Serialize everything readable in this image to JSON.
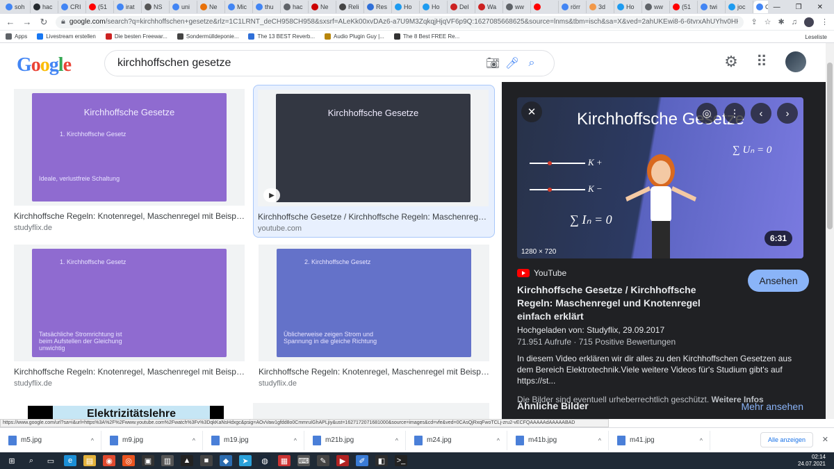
{
  "tabs": [
    {
      "label": "soh",
      "color": "#4285f4"
    },
    {
      "label": "hac",
      "color": "#24292e"
    },
    {
      "label": "CRI",
      "color": "#4285f4"
    },
    {
      "label": "(51",
      "color": "#ff0000"
    },
    {
      "label": "irat",
      "color": "#4285f4"
    },
    {
      "label": "NS",
      "color": "#555555"
    },
    {
      "label": "uni",
      "color": "#4285f4"
    },
    {
      "label": "Ne",
      "color": "#e8710a"
    },
    {
      "label": "Mic",
      "color": "#4285f4"
    },
    {
      "label": "thu",
      "color": "#4285f4"
    },
    {
      "label": "hac",
      "color": "#5f6368"
    },
    {
      "label": "Ne",
      "color": "#cc0000"
    },
    {
      "label": "Reli",
      "color": "#444444"
    },
    {
      "label": "Res",
      "color": "#2f6fd8"
    },
    {
      "label": "Ho",
      "color": "#1d9bf0"
    },
    {
      "label": "Ho",
      "color": "#1d9bf0"
    },
    {
      "label": "Del",
      "color": "#cc2222"
    },
    {
      "label": "Wa",
      "color": "#cc2222"
    },
    {
      "label": "ww",
      "color": "#5f6368"
    },
    {
      "label": "",
      "color": "#ff0000"
    },
    {
      "label": "rörr",
      "color": "#4285f4"
    },
    {
      "label": "3d",
      "color": "#f2994a"
    },
    {
      "label": "Ho",
      "color": "#1d9bf0"
    },
    {
      "label": "ww",
      "color": "#5f6368"
    },
    {
      "label": "(51",
      "color": "#ff0000"
    },
    {
      "label": "twi",
      "color": "#4285f4"
    },
    {
      "label": "joc",
      "color": "#1d9bf0"
    }
  ],
  "active_tab": {
    "label": "G",
    "color": "#4285f4"
  },
  "window": {
    "minimize": "—",
    "restore": "❐",
    "close": "✕"
  },
  "address": {
    "domain": "google.com",
    "rest": "/search?q=kirchhoffschen+gesetze&rlz=1C1LRNT_deCH958CH958&sxsrf=ALeKk00xvDAz6-a7U9M3ZqkqjHjqVF6p9Q:1627085668625&source=lnms&tbm=isch&sa=X&ved=2ahUKEwi8-6-6tvrxAhUYhv0HHa72D24Q_AUoAXoECAEQAw&biw=..."
  },
  "bookmarks": [
    {
      "label": "Apps",
      "color": "#5f6368"
    },
    {
      "label": "Livestream erstellen",
      "color": "#1877f2"
    },
    {
      "label": "Die besten Freewar...",
      "color": "#cc2222"
    },
    {
      "label": "Sondermülldeponie...",
      "color": "#444444"
    },
    {
      "label": "The 13 BEST Reverb...",
      "color": "#2f6fd8"
    },
    {
      "label": "Audio Plugin Guy |...",
      "color": "#b8860b"
    },
    {
      "label": "The 8 Best FREE Re...",
      "color": "#333333"
    }
  ],
  "reading_list": "Leseliste",
  "logo_text": [
    "G",
    "o",
    "o",
    "g",
    "l",
    "e"
  ],
  "search": {
    "query": "kirchhoffschen gesetze"
  },
  "results": [
    {
      "thumb_title": "Kirchhoffsche Gesetze",
      "title": "Kirchhoffsche Regeln: Knotenregel, Maschenregel mit Beispie...",
      "source": "studyflix.de",
      "line1": "1. Kirchhoffsche Gesetz",
      "line2": "Ideale, verlustfreie Schaltung",
      "color": "#8f6bd0"
    },
    {
      "thumb_title": "Kirchhoffsche Gesetze",
      "title": "Kirchhoffsche Gesetze / Kirchhoffsche Regeln: Maschenregel...",
      "source": "youtube.com",
      "line1": "",
      "line2": "",
      "color": "#333742"
    },
    {
      "thumb_title": "",
      "title": "Kirchhoffsche Regeln: Knotenregel, Maschenregel mit Beispie...",
      "source": "studyflix.de",
      "line1": "1. Kirchhoffsche Gesetz",
      "line2": "Tatsächliche Stromrichtung ist beim Aufstellen der Gleichung unwichtig",
      "color": "#8f6bd0"
    },
    {
      "thumb_title": "",
      "title": "Kirchhoffsche Regeln: Knotenregel, Maschenregel mit Beispie...",
      "source": "studyflix.de",
      "line1": "2. Kirchhoffsche Gesetz",
      "line2": "Üblicherweise zeigen Strom und Spannung in die gleiche Richtung",
      "color": "#6472c9"
    }
  ],
  "partial_card_title": "Elektrizitätslehre",
  "preview": {
    "title": "Kirchhoffsche Gesetze",
    "resolution": "1280 × 720",
    "duration": "6:31",
    "sum1": "∑ Iₙ = 0",
    "sum2": "∑ Uₙ = 0",
    "k1": "K  +",
    "k2": "K  −",
    "source": "YouTube",
    "watch": "Ansehen",
    "heading": "Kirchhoffsche Gesetze / Kirchhoffsche Regeln: Maschenregel und Knotenregel einfach erklärt",
    "uploaded": "Hochgeladen von: Studyflix, 29.09.2017",
    "stats": "71.951 Aufrufe · 715 Positive Bewertungen",
    "description": "In diesem Video erklären wir dir alles zu den Kirchhoffschen Gesetzen aus dem Bereich Elektrotechnik.Viele weitere Videos für's Studium gibt's auf https://st...",
    "copyright": "Die Bilder sind eventuell urheberrechtlich geschützt.",
    "more_info": "Weitere Infos",
    "similar": "Ähnliche Bilder",
    "see_more": "Mehr ansehen"
  },
  "status_url": "https://www.google.com/url?sa=i&url=https%3A%2F%2Fwww.youtube.com%2Fwatch%3Fv%3DqkKaNsHdxgc&psig=AOvVaw1gfdd8o0CmmruIGhAPLjiy&ust=1627172071681000&source=images&cd=vfe&ved=0CAsQjRxqFwoTCLj-zru2-vECFQAAAAAdAAAAABAD",
  "downloads": [
    "m5.jpg",
    "m9.jpg",
    "m19.jpg",
    "m21b.jpg",
    "m24.jpg",
    "m41b.jpg",
    "m41.jpg"
  ],
  "show_all": "Alle anzeigen",
  "clock": {
    "time": "02:14",
    "date": "24.07.2021"
  },
  "taskbar_icons": [
    {
      "name": "windows-start-icon",
      "color": "#1f2a36",
      "glyph": "⊞"
    },
    {
      "name": "search-icon",
      "color": "#1f2a36",
      "glyph": "⌕"
    },
    {
      "name": "taskview-icon",
      "color": "#1f2a36",
      "glyph": "▭"
    },
    {
      "name": "edge-icon",
      "color": "#1b8fd6",
      "glyph": "e"
    },
    {
      "name": "explorer-icon",
      "color": "#e3b23c",
      "glyph": "▤"
    },
    {
      "name": "chrome-icon",
      "color": "#e04a2f",
      "glyph": "◉"
    },
    {
      "name": "ubuntu-icon",
      "color": "#e95420",
      "glyph": "◎"
    },
    {
      "name": "terminal-icon",
      "color": "#333333",
      "glyph": "▣"
    },
    {
      "name": "app-icon",
      "color": "#555555",
      "glyph": "▥"
    },
    {
      "name": "triangle-app-icon",
      "color": "#222222",
      "glyph": "▲"
    },
    {
      "name": "live-app-icon",
      "color": "#444444",
      "glyph": "■"
    },
    {
      "name": "photos-icon",
      "color": "#2b6cb0",
      "glyph": "◆"
    },
    {
      "name": "telegram-icon",
      "color": "#2aa1da",
      "glyph": "➤"
    },
    {
      "name": "steam-icon",
      "color": "#1b2838",
      "glyph": "◍"
    },
    {
      "name": "red-app-icon",
      "color": "#cc3333",
      "glyph": "▦"
    },
    {
      "name": "keyboard-icon",
      "color": "#555555",
      "glyph": "⌨"
    },
    {
      "name": "tool-icon",
      "color": "#444444",
      "glyph": "✎"
    },
    {
      "name": "video-app-icon",
      "color": "#b22222",
      "glyph": "▶"
    },
    {
      "name": "pen-app-icon",
      "color": "#3a7bd5",
      "glyph": "✐"
    },
    {
      "name": "media-icon",
      "color": "#2d2d2d",
      "glyph": "◧"
    },
    {
      "name": "console-icon",
      "color": "#222222",
      "glyph": ">_"
    }
  ]
}
